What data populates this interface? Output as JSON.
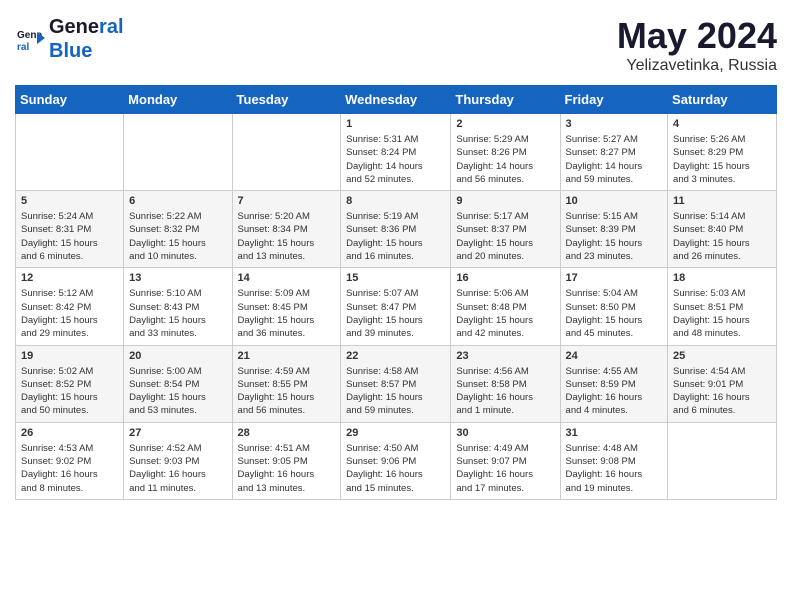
{
  "header": {
    "logo_line1": "General",
    "logo_line2": "Blue",
    "month_year": "May 2024",
    "location": "Yelizavetinka, Russia"
  },
  "days_of_week": [
    "Sunday",
    "Monday",
    "Tuesday",
    "Wednesday",
    "Thursday",
    "Friday",
    "Saturday"
  ],
  "weeks": [
    [
      {
        "day": "",
        "info": ""
      },
      {
        "day": "",
        "info": ""
      },
      {
        "day": "",
        "info": ""
      },
      {
        "day": "1",
        "info": "Sunrise: 5:31 AM\nSunset: 8:24 PM\nDaylight: 14 hours\nand 52 minutes."
      },
      {
        "day": "2",
        "info": "Sunrise: 5:29 AM\nSunset: 8:26 PM\nDaylight: 14 hours\nand 56 minutes."
      },
      {
        "day": "3",
        "info": "Sunrise: 5:27 AM\nSunset: 8:27 PM\nDaylight: 14 hours\nand 59 minutes."
      },
      {
        "day": "4",
        "info": "Sunrise: 5:26 AM\nSunset: 8:29 PM\nDaylight: 15 hours\nand 3 minutes."
      }
    ],
    [
      {
        "day": "5",
        "info": "Sunrise: 5:24 AM\nSunset: 8:31 PM\nDaylight: 15 hours\nand 6 minutes."
      },
      {
        "day": "6",
        "info": "Sunrise: 5:22 AM\nSunset: 8:32 PM\nDaylight: 15 hours\nand 10 minutes."
      },
      {
        "day": "7",
        "info": "Sunrise: 5:20 AM\nSunset: 8:34 PM\nDaylight: 15 hours\nand 13 minutes."
      },
      {
        "day": "8",
        "info": "Sunrise: 5:19 AM\nSunset: 8:36 PM\nDaylight: 15 hours\nand 16 minutes."
      },
      {
        "day": "9",
        "info": "Sunrise: 5:17 AM\nSunset: 8:37 PM\nDaylight: 15 hours\nand 20 minutes."
      },
      {
        "day": "10",
        "info": "Sunrise: 5:15 AM\nSunset: 8:39 PM\nDaylight: 15 hours\nand 23 minutes."
      },
      {
        "day": "11",
        "info": "Sunrise: 5:14 AM\nSunset: 8:40 PM\nDaylight: 15 hours\nand 26 minutes."
      }
    ],
    [
      {
        "day": "12",
        "info": "Sunrise: 5:12 AM\nSunset: 8:42 PM\nDaylight: 15 hours\nand 29 minutes."
      },
      {
        "day": "13",
        "info": "Sunrise: 5:10 AM\nSunset: 8:43 PM\nDaylight: 15 hours\nand 33 minutes."
      },
      {
        "day": "14",
        "info": "Sunrise: 5:09 AM\nSunset: 8:45 PM\nDaylight: 15 hours\nand 36 minutes."
      },
      {
        "day": "15",
        "info": "Sunrise: 5:07 AM\nSunset: 8:47 PM\nDaylight: 15 hours\nand 39 minutes."
      },
      {
        "day": "16",
        "info": "Sunrise: 5:06 AM\nSunset: 8:48 PM\nDaylight: 15 hours\nand 42 minutes."
      },
      {
        "day": "17",
        "info": "Sunrise: 5:04 AM\nSunset: 8:50 PM\nDaylight: 15 hours\nand 45 minutes."
      },
      {
        "day": "18",
        "info": "Sunrise: 5:03 AM\nSunset: 8:51 PM\nDaylight: 15 hours\nand 48 minutes."
      }
    ],
    [
      {
        "day": "19",
        "info": "Sunrise: 5:02 AM\nSunset: 8:52 PM\nDaylight: 15 hours\nand 50 minutes."
      },
      {
        "day": "20",
        "info": "Sunrise: 5:00 AM\nSunset: 8:54 PM\nDaylight: 15 hours\nand 53 minutes."
      },
      {
        "day": "21",
        "info": "Sunrise: 4:59 AM\nSunset: 8:55 PM\nDaylight: 15 hours\nand 56 minutes."
      },
      {
        "day": "22",
        "info": "Sunrise: 4:58 AM\nSunset: 8:57 PM\nDaylight: 15 hours\nand 59 minutes."
      },
      {
        "day": "23",
        "info": "Sunrise: 4:56 AM\nSunset: 8:58 PM\nDaylight: 16 hours\nand 1 minute."
      },
      {
        "day": "24",
        "info": "Sunrise: 4:55 AM\nSunset: 8:59 PM\nDaylight: 16 hours\nand 4 minutes."
      },
      {
        "day": "25",
        "info": "Sunrise: 4:54 AM\nSunset: 9:01 PM\nDaylight: 16 hours\nand 6 minutes."
      }
    ],
    [
      {
        "day": "26",
        "info": "Sunrise: 4:53 AM\nSunset: 9:02 PM\nDaylight: 16 hours\nand 8 minutes."
      },
      {
        "day": "27",
        "info": "Sunrise: 4:52 AM\nSunset: 9:03 PM\nDaylight: 16 hours\nand 11 minutes."
      },
      {
        "day": "28",
        "info": "Sunrise: 4:51 AM\nSunset: 9:05 PM\nDaylight: 16 hours\nand 13 minutes."
      },
      {
        "day": "29",
        "info": "Sunrise: 4:50 AM\nSunset: 9:06 PM\nDaylight: 16 hours\nand 15 minutes."
      },
      {
        "day": "30",
        "info": "Sunrise: 4:49 AM\nSunset: 9:07 PM\nDaylight: 16 hours\nand 17 minutes."
      },
      {
        "day": "31",
        "info": "Sunrise: 4:48 AM\nSunset: 9:08 PM\nDaylight: 16 hours\nand 19 minutes."
      },
      {
        "day": "",
        "info": ""
      }
    ]
  ]
}
